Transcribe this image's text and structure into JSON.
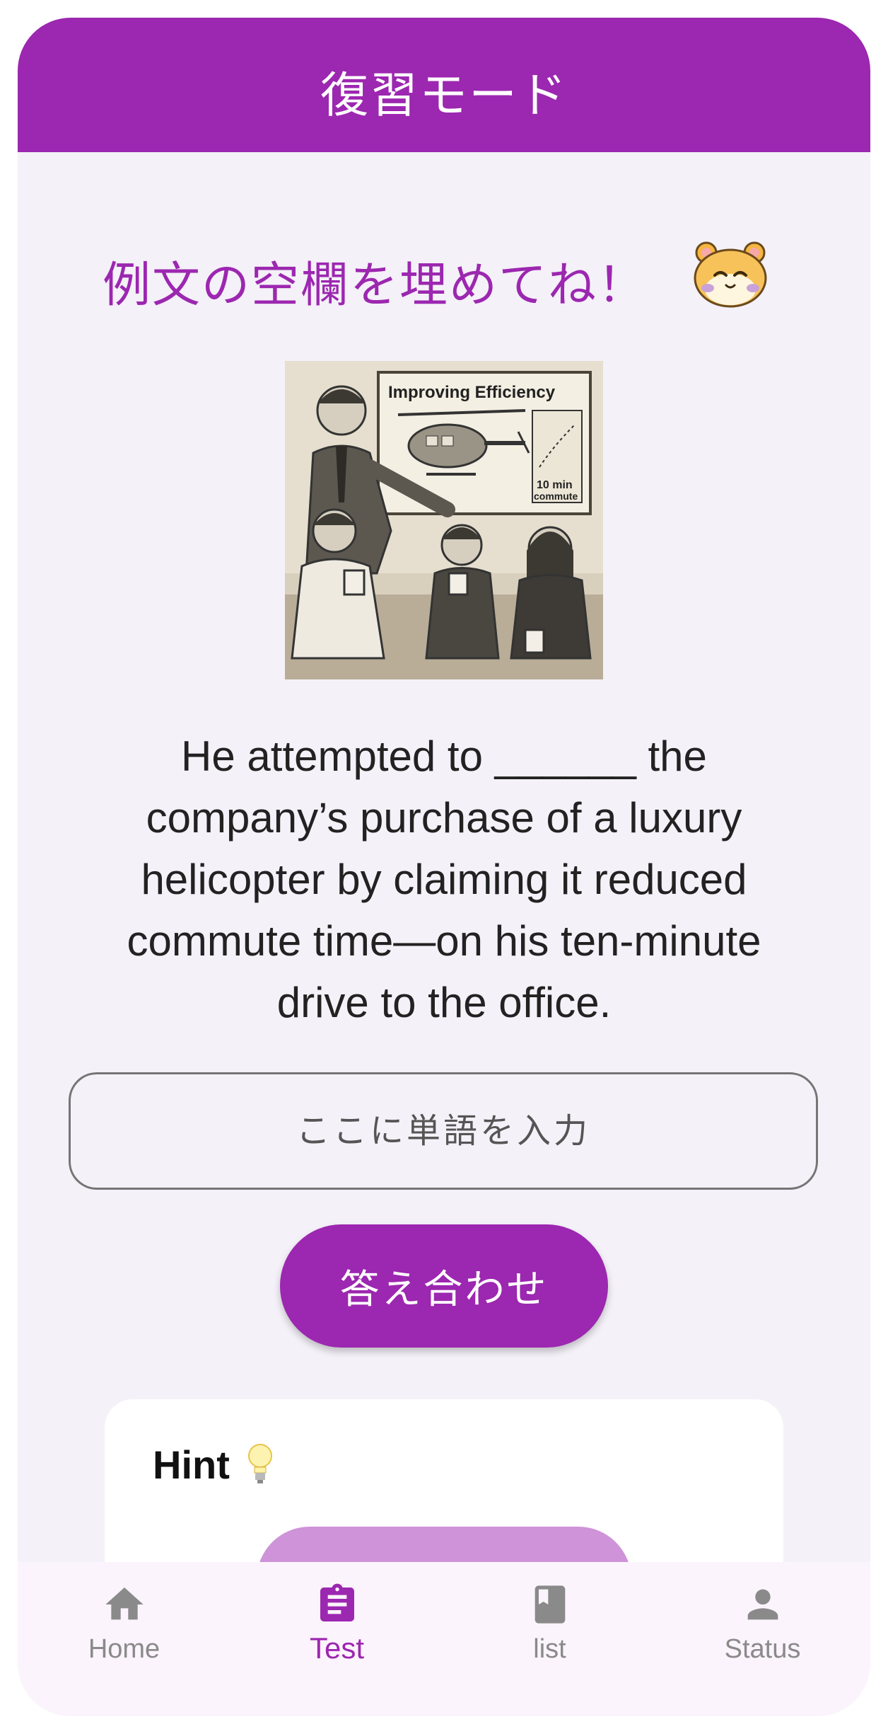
{
  "appbar": {
    "title": "復習モード"
  },
  "prompt": {
    "text": "例文の空欄を埋めてね！",
    "mascot_icon": "hamster-face-icon"
  },
  "illustration": {
    "sign_title": "Improving Efficiency",
    "sign_note_line1": "10 min",
    "sign_note_line2": "commute"
  },
  "sentence": "He attempted to ______ the company’s purchase of a luxury helicopter by claiming it reduced commute time—on his ten-minute drive to the office.",
  "answer_input": {
    "placeholder": "ここに単語を入力",
    "value": ""
  },
  "check_button": {
    "label": "答え合わせ"
  },
  "hint": {
    "title": "Hint",
    "icon": "lightbulb-icon"
  },
  "nav": {
    "items": [
      {
        "label": "Home",
        "icon": "home-icon"
      },
      {
        "label": "Test",
        "icon": "clipboard-icon",
        "active": true
      },
      {
        "label": "list",
        "icon": "book-icon"
      },
      {
        "label": "Status",
        "icon": "person-icon"
      }
    ]
  },
  "colors": {
    "primary": "#9c27b0",
    "primary_light": "#ce93d8",
    "background": "#f4f1f8",
    "nav_background": "#fcf4fc"
  }
}
